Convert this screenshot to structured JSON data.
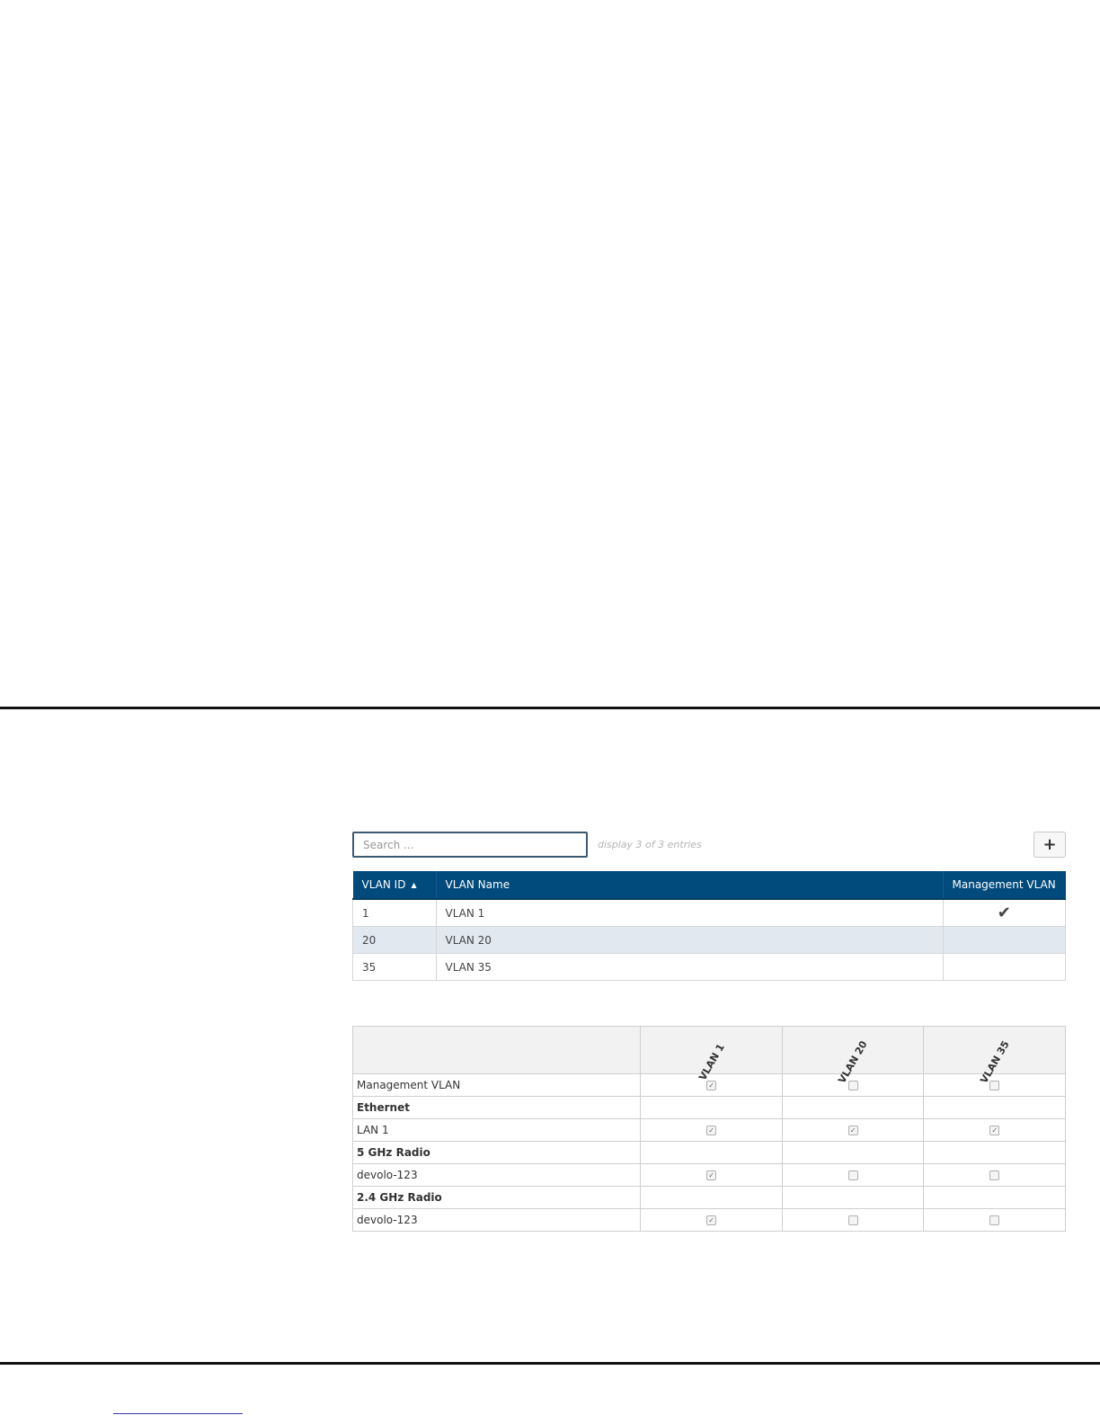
{
  "toolbar": {
    "search_placeholder": "Search ...",
    "entry_count": "display 3 of 3 entries",
    "add_icon": "plus-icon",
    "add_glyph": "+"
  },
  "vlan_table": {
    "columns": [
      "VLAN ID",
      "VLAN Name",
      "Management VLAN"
    ],
    "sort": {
      "column": "VLAN ID",
      "direction": "ascending",
      "glyph": "▲"
    },
    "selected_row": 1,
    "rows": [
      {
        "id": "1",
        "name": "VLAN 1",
        "management": true,
        "management_glyph": "✔"
      },
      {
        "id": "20",
        "name": "VLAN 20",
        "management": false,
        "management_glyph": ""
      },
      {
        "id": "35",
        "name": "VLAN 35",
        "management": false,
        "management_glyph": ""
      }
    ]
  },
  "matrix": {
    "columns": [
      "VLAN 1",
      "VLAN 20",
      "VLAN 35"
    ],
    "rows": [
      {
        "label": "Management VLAN",
        "group": false,
        "values": [
          true,
          false,
          false
        ]
      },
      {
        "label": "Ethernet",
        "group": true
      },
      {
        "label": "LAN 1",
        "group": false,
        "values": [
          true,
          true,
          true
        ]
      },
      {
        "label": "5 GHz Radio",
        "group": true
      },
      {
        "label": "devolo-123",
        "group": false,
        "values": [
          true,
          false,
          false
        ]
      },
      {
        "label": "2.4 GHz Radio",
        "group": true
      },
      {
        "label": "devolo-123",
        "group": false,
        "values": [
          true,
          false,
          false
        ]
      }
    ],
    "check_glyph": "✓"
  },
  "colors": {
    "header_bg": "#004b7c",
    "selected_row_bg": "#e1e8ef",
    "search_border": "#3d5a73"
  }
}
